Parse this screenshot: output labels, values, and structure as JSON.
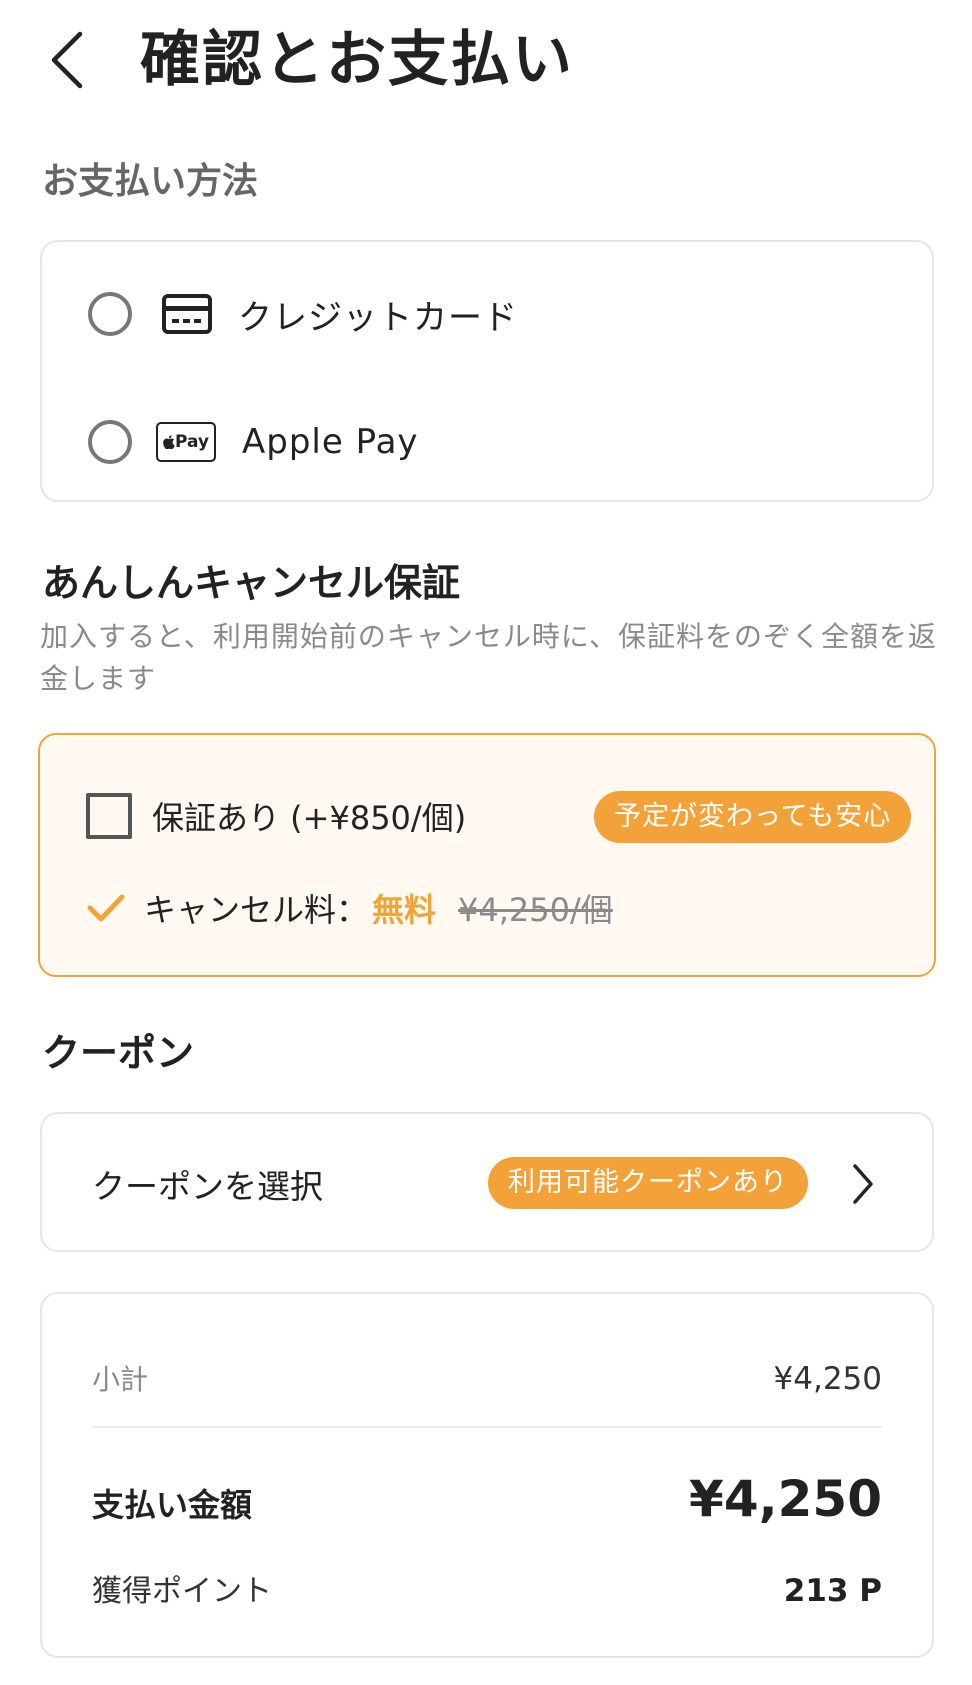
{
  "header": {
    "title": "確認とお支払い",
    "back_icon": "chevron-left-icon"
  },
  "payment": {
    "section_label": "お支払い方法",
    "methods": [
      {
        "label": "クレジットカード",
        "icon": "credit-card-icon",
        "selected": false
      },
      {
        "label": "Apple Pay",
        "icon": "apple-pay-icon",
        "icon_text": "Pay",
        "selected": false
      }
    ]
  },
  "guarantee": {
    "title": "あんしんキャンセル保証",
    "description": "加入すると、利用開始前のキャンセル時に、保証料をのぞく全額を返金します",
    "option_label": "保証あり (+¥850/個)",
    "checked": false,
    "badge": "予定が変わっても安心",
    "fee_label": "キャンセル料：",
    "fee_value": "無料",
    "fee_original": "¥4,250/個"
  },
  "coupon": {
    "title": "クーポン",
    "select_label": "クーポンを選択",
    "badge": "利用可能クーポンあり"
  },
  "summary": {
    "subtotal_label": "小計",
    "subtotal_value": "¥4,250",
    "total_label": "支払い金額",
    "total_value": "¥4,250",
    "points_label": "獲得ポイント",
    "points_value": "213 P"
  },
  "colors": {
    "accent": "#f3a23a",
    "guarantee_bg": "#fff9f1",
    "muted_text": "#8a8a8a",
    "border": "#e6e6e6"
  }
}
